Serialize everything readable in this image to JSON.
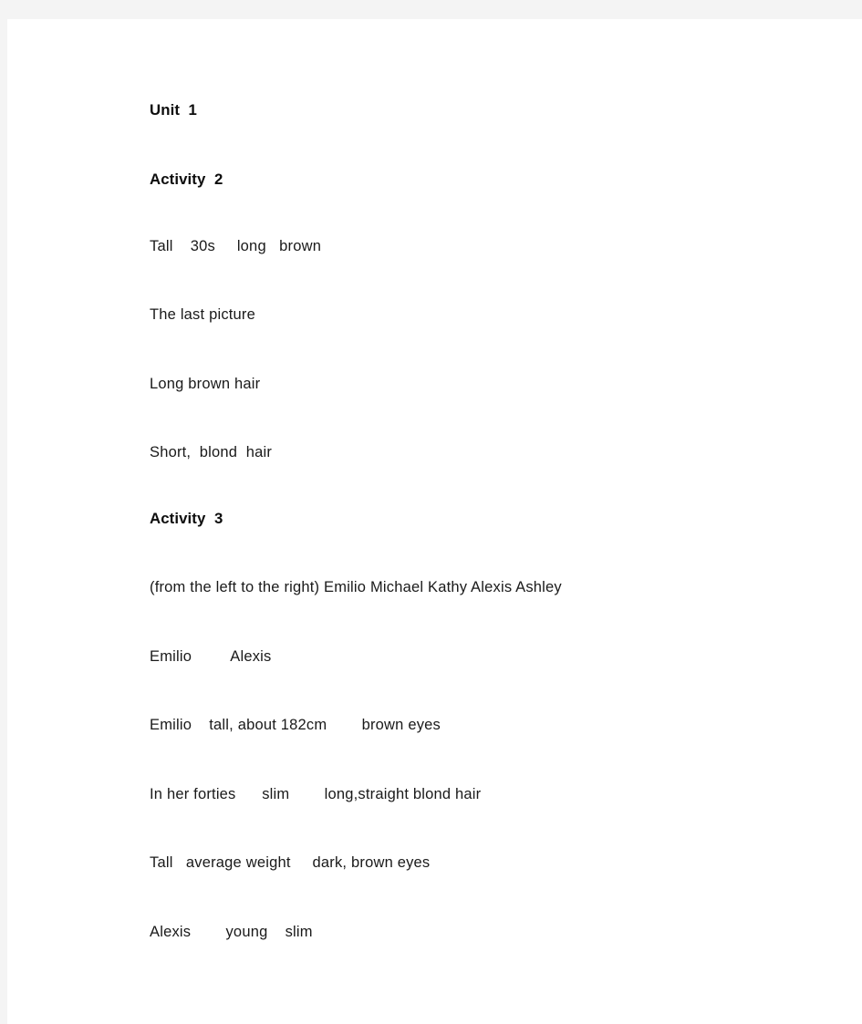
{
  "document": {
    "page_background": "#ffffff",
    "app_background": "#f4f4f4",
    "text_color": "#1a1a1a",
    "unit_heading": "Unit  1",
    "sections": [
      {
        "heading": "Activity  2",
        "lines": [
          "Tall    30s     long   brown",
          "The last picture",
          "Long brown hair",
          "Short,  blond  hair"
        ]
      },
      {
        "heading": "Activity  3",
        "lines": [
          "(from the left to the right) Emilio Michael Kathy Alexis Ashley",
          "Emilio         Alexis",
          "Emilio    tall, about 182cm        brown eyes",
          "In her forties      slim        long,straight blond hair",
          "Tall   average weight     dark, brown eyes",
          "Alexis        young    slim"
        ]
      }
    ]
  }
}
